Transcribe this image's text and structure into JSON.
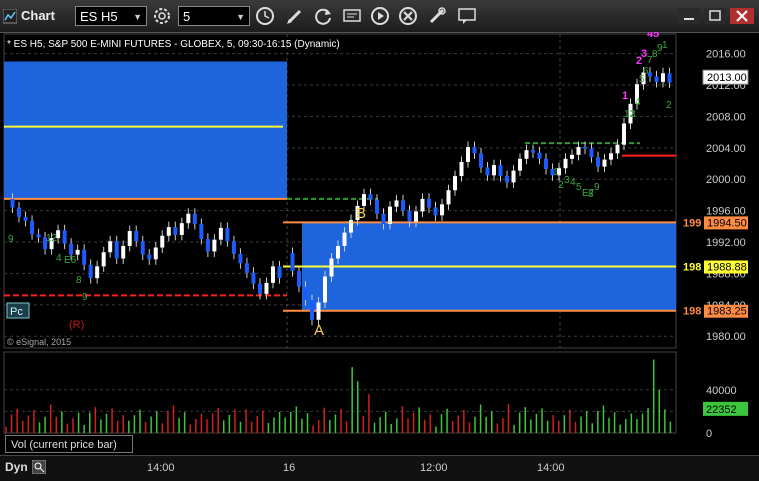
{
  "window": {
    "title": "Chart"
  },
  "toolbar": {
    "symbol": "ES H5",
    "interval": "5"
  },
  "chart_data": {
    "type": "candlestick",
    "title": "* ES H5, S&P 500 E-MINI FUTURES - GLOBEX, 5, 09:30-16:15 (Dynamic)",
    "watermark": "© eSignal, 2015",
    "last_price_label": "2013.00",
    "y_ticks": [
      "2016.00",
      "2012.00",
      "2008.00",
      "2004.00",
      "2000.00",
      "1996.00",
      "1992.00",
      "1988.00",
      "1984.00",
      "1980.00"
    ],
    "ylim": [
      1978.5,
      2018.5
    ],
    "x_ticks": [
      "14:00",
      "16",
      "12:00",
      "14:00"
    ],
    "levels": [
      {
        "label": "1994.50",
        "value": 1994.5,
        "color": "#ff8c42",
        "prefix": "199"
      },
      {
        "label": "1988.88",
        "value": 1988.88,
        "color": "#ffff33",
        "prefix": "198"
      },
      {
        "label": "1983.25",
        "value": 1983.25,
        "color": "#ff8c42",
        "prefix": "198"
      }
    ],
    "prior_day_box": {
      "top": 2015.0,
      "bottom": 1997.5,
      "mid": 2006.7
    },
    "labels": {
      "pc": "Pc",
      "r": "(R)",
      "a": "A",
      "b": "B"
    },
    "td_numbers": [
      "9",
      "12",
      "4",
      "E6",
      "8",
      "9",
      "1",
      "2",
      "3",
      "4",
      "5",
      "E7",
      "8",
      "9",
      "12",
      "3",
      "4",
      "5",
      "6",
      "7",
      "8",
      "9",
      "1",
      "2",
      "3",
      "1",
      "2",
      "3",
      "4",
      "5"
    ],
    "volume": {
      "label": "Vol (current price bar)",
      "current_label": "22352",
      "y_ticks": [
        "40000",
        "20000",
        "0"
      ],
      "ymax": 75000
    }
  }
}
